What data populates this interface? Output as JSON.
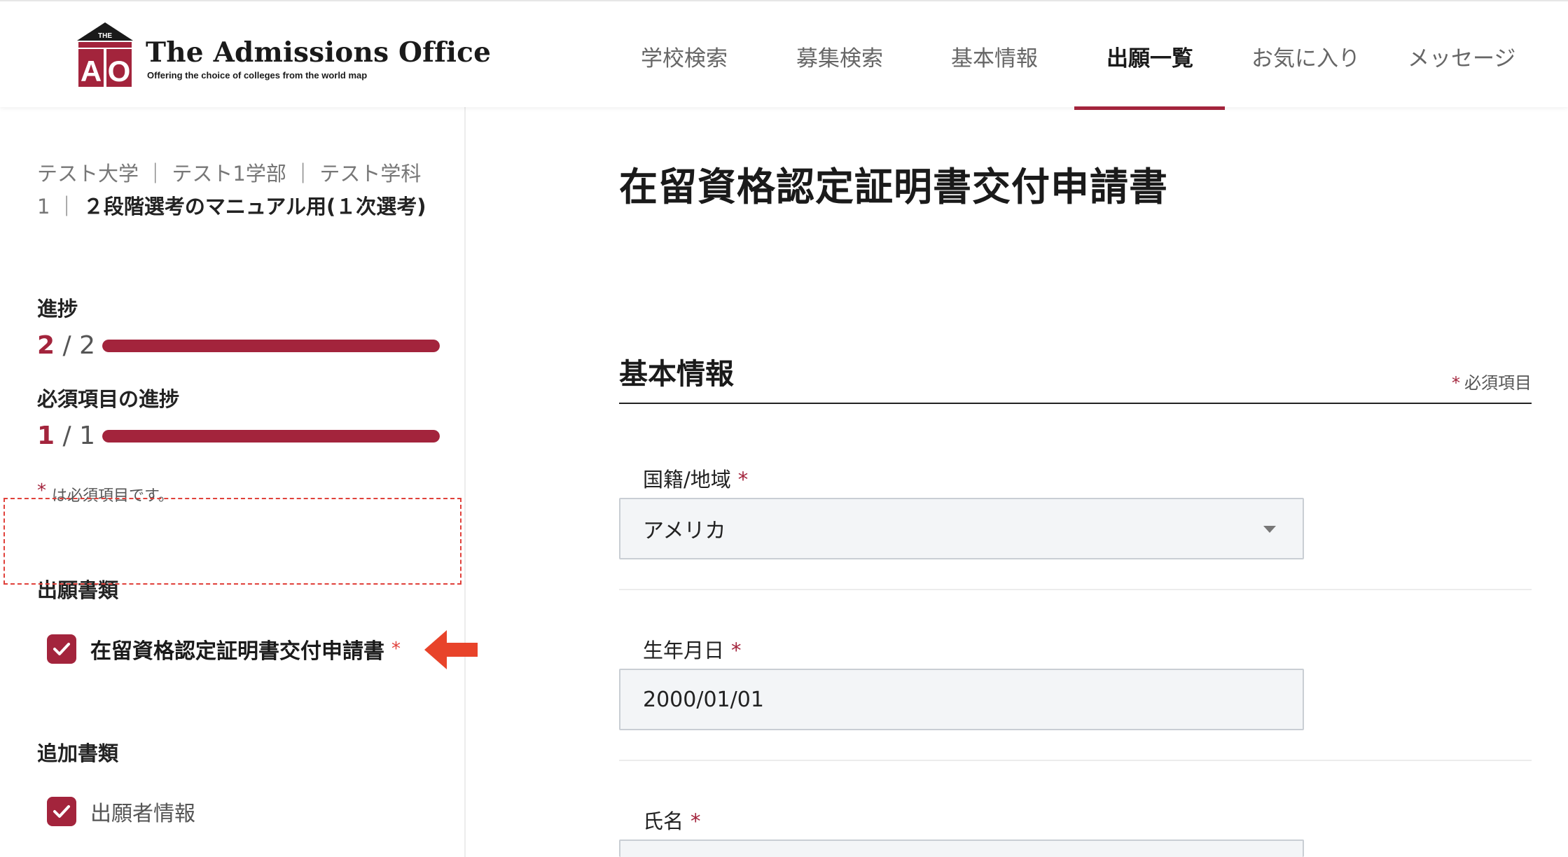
{
  "header": {
    "logo": {
      "mark_top": "THE",
      "mark_letters": "AO",
      "title": "The Admissions Office",
      "subtitle": "Offering the choice of colleges from the world map"
    },
    "nav": [
      {
        "label": "学校検索",
        "active": false
      },
      {
        "label": "募集検索",
        "active": false
      },
      {
        "label": "基本情報",
        "active": false
      },
      {
        "label": "出願一覧",
        "active": true
      },
      {
        "label": "お気に入り",
        "active": false
      },
      {
        "label": "メッセージ",
        "active": false
      }
    ]
  },
  "sidebar": {
    "breadcrumb": {
      "path": "テスト大学 ｜ テスト1学部 ｜ テスト学科1 ｜ ",
      "current": "２段階選考のマニュアル用(１次選考)"
    },
    "progress": {
      "label": "進捗",
      "current": "2",
      "sep": " / ",
      "total": "2",
      "ratio": 1.0
    },
    "required_progress": {
      "label": "必須項目の進捗",
      "current": "1",
      "sep": " / ",
      "total": "1",
      "ratio": 1.0
    },
    "required_note": {
      "star": "*",
      "text": "は必須項目です。"
    },
    "application_docs": {
      "heading": "出願書類",
      "items": [
        {
          "label": "在留資格認定証明書交付申請書",
          "required_star": "*",
          "checked": true
        }
      ]
    },
    "additional_docs": {
      "heading": "追加書類",
      "items": [
        {
          "label": "出願者情報",
          "checked": true
        }
      ]
    }
  },
  "main": {
    "page_title": "在留資格認定証明書交付申請書",
    "section": {
      "title": "基本情報",
      "required_star": "*",
      "required_label": "必須項目"
    },
    "fields": [
      {
        "label": "国籍/地域",
        "star": "*",
        "value": "アメリカ",
        "type": "select"
      },
      {
        "label": "生年月日",
        "star": "*",
        "value": "2000/01/01",
        "type": "text"
      },
      {
        "label": "氏名",
        "star": "*",
        "value": "",
        "type": "text"
      }
    ]
  },
  "colors": {
    "accent": "#a3243c",
    "annotation_red": "#e0413b",
    "field_bg": "#f3f5f7"
  }
}
